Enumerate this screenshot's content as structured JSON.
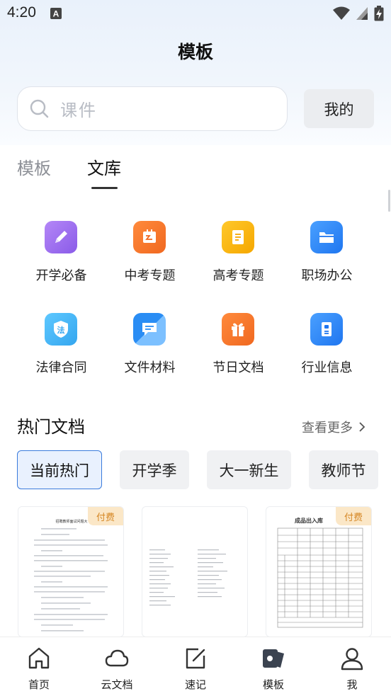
{
  "status": {
    "time": "4:20",
    "notif_glyph": "A",
    "icons": [
      "wifi-icon",
      "signal-icon",
      "battery-charging-icon"
    ]
  },
  "header": {
    "title": "模板"
  },
  "search": {
    "placeholder": "课件"
  },
  "mine_button": "我的",
  "tabs": [
    {
      "label": "模板",
      "active": false
    },
    {
      "label": "文库",
      "active": true
    }
  ],
  "categories": [
    {
      "label": "开学必备",
      "icon": "pencil-icon",
      "color": "#9b6cf0"
    },
    {
      "label": "中考专题",
      "icon": "board-icon",
      "color": "#f4742a"
    },
    {
      "label": "高考专题",
      "icon": "note-icon",
      "color": "#f7b500"
    },
    {
      "label": "职场办公",
      "icon": "folder-icon",
      "color": "#2f86f6"
    },
    {
      "label": "法律合同",
      "icon": "law-shield-icon",
      "color": "#46b4f3"
    },
    {
      "label": "文件材料",
      "icon": "message-doc-icon",
      "color": "#2a8df4"
    },
    {
      "label": "节日文档",
      "icon": "gift-icon",
      "color": "#f6782a"
    },
    {
      "label": "行业信息",
      "icon": "id-card-icon",
      "color": "#2f86f6"
    }
  ],
  "hot_docs": {
    "title": "热门文档",
    "see_more": "查看更多",
    "chips": [
      {
        "label": "当前热门",
        "active": true
      },
      {
        "label": "开学季"
      },
      {
        "label": "大一新生"
      },
      {
        "label": "教师节"
      }
    ],
    "cards": [
      {
        "paid_label": "付费",
        "paid": true,
        "preview_heading": "招聘教师面试问题大"
      },
      {
        "paid": false
      },
      {
        "paid_label": "付费",
        "paid": true,
        "preview_heading": "成品出入库"
      }
    ]
  },
  "bottom_nav": [
    {
      "label": "首页",
      "icon": "home-icon"
    },
    {
      "label": "云文档",
      "icon": "cloud-icon"
    },
    {
      "label": "速记",
      "icon": "edit-note-icon"
    },
    {
      "label": "模板",
      "icon": "template-icon",
      "active": true
    },
    {
      "label": "我",
      "icon": "profile-icon"
    }
  ]
}
